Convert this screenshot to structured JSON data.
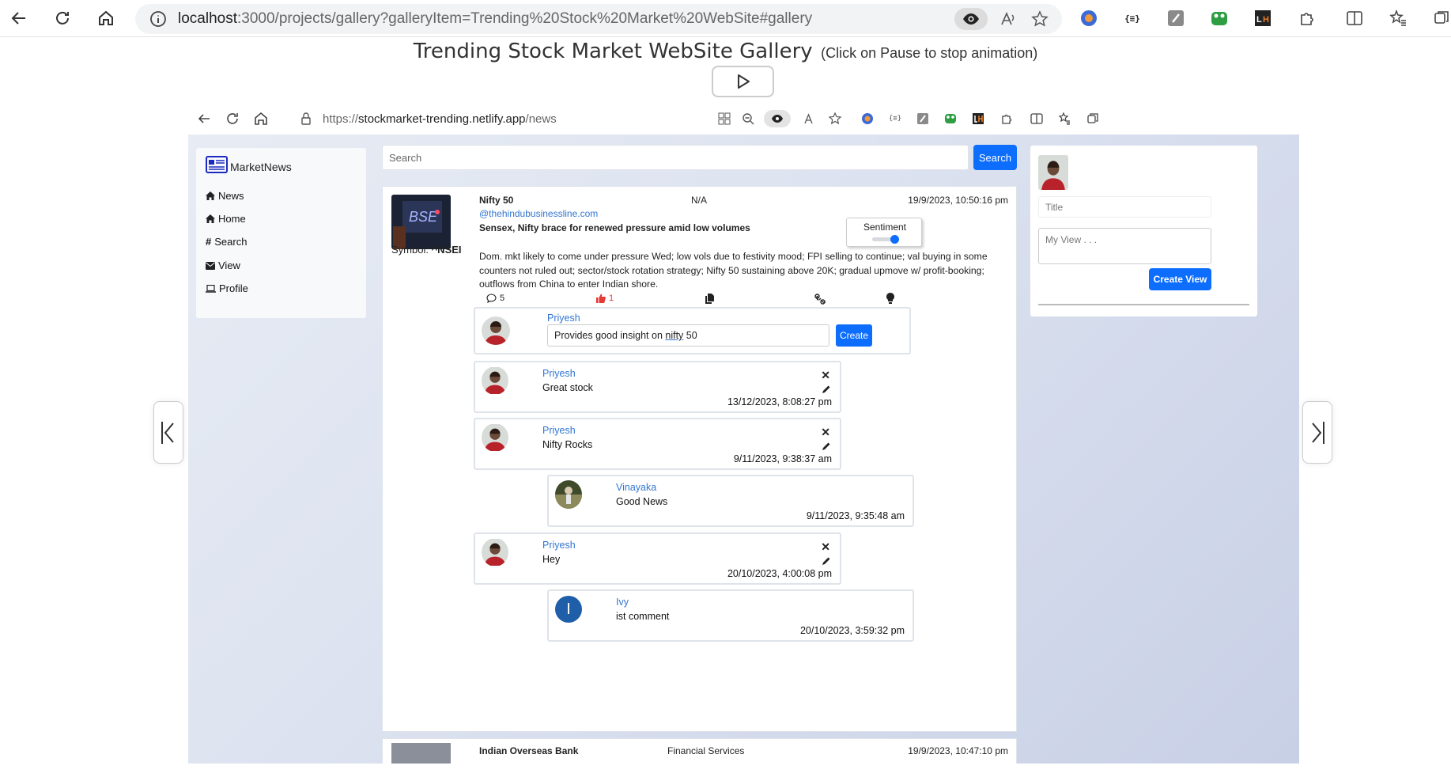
{
  "browser": {
    "url_host": "localhost",
    "url_rest": ":3000/projects/gallery?galleryItem=Trending%20Stock%20Market%20WebSite#gallery"
  },
  "gallery": {
    "title": "Trending Stock Market WebSite Gallery",
    "subtitle": "(Click on Pause to stop animation)"
  },
  "inner_browser": {
    "url_scheme": "https://",
    "url_host": "stockmarket-trending.netlify.app",
    "url_path": "/news"
  },
  "sidebar": {
    "brand": "MarketNews",
    "items": [
      {
        "icon": "home-icon",
        "label": "News"
      },
      {
        "icon": "home-icon",
        "label": "Home"
      },
      {
        "icon": "hash-icon",
        "label": "Search"
      },
      {
        "icon": "envelope-icon",
        "label": "View"
      },
      {
        "icon": "laptop-icon",
        "label": "Profile"
      }
    ]
  },
  "search": {
    "placeholder": "Search",
    "button": "Search"
  },
  "news": {
    "title": "Nifty 50",
    "category": "N/A",
    "date": "19/9/2023, 10:50:16 pm",
    "source": "@thehindubusinessline.com",
    "headline": "Sensex, Nifty brace for renewed pressure amid low volumes",
    "sentiment_label": "Sentiment",
    "symbol_label": "Symbol:",
    "symbol": "^NSEI",
    "body": "Dom. mkt likely to come under pressure Wed; low vols due to festivity mood; FPI selling to continue; val buying in some counters not ruled out; sector/stock rotation strategy; Nifty 50 sustaining above 20K; gradual upmove w/ profit-booking; outflows from China to enter Indian shore.",
    "comments_count": "5",
    "likes_count": "1"
  },
  "composer": {
    "user": "Priyesh",
    "text_prefix": "Provides good insight on ",
    "text_link": "nifty",
    "text_suffix": " 50",
    "button": "Create"
  },
  "comments": [
    {
      "user": "Priyesh",
      "text": "Great stock",
      "date": "13/12/2023, 8:08:27 pm"
    },
    {
      "user": "Priyesh",
      "text": "Nifty Rocks",
      "date": "9/11/2023, 9:38:37 am"
    },
    {
      "user": "Vinayaka",
      "text": "Good News",
      "date": "9/11/2023, 9:35:48 am"
    },
    {
      "user": "Priyesh",
      "text": "Hey",
      "date": "20/10/2023, 4:00:08 pm"
    },
    {
      "user": "Ivy",
      "text": "ist comment",
      "date": "20/10/2023, 3:59:32 pm",
      "avatar_letter": "I"
    }
  ],
  "next_news": {
    "title": "Indian Overseas Bank",
    "category": "Financial Services",
    "date": "19/9/2023, 10:47:10 pm"
  },
  "views": {
    "title_placeholder": "Title",
    "body_placeholder": "My View . . .",
    "button": "Create View"
  },
  "colors": {
    "primary": "#0d6efd",
    "link": "#3276d1",
    "like": "#e53935",
    "ivy_avatar": "#1f5ea8"
  }
}
